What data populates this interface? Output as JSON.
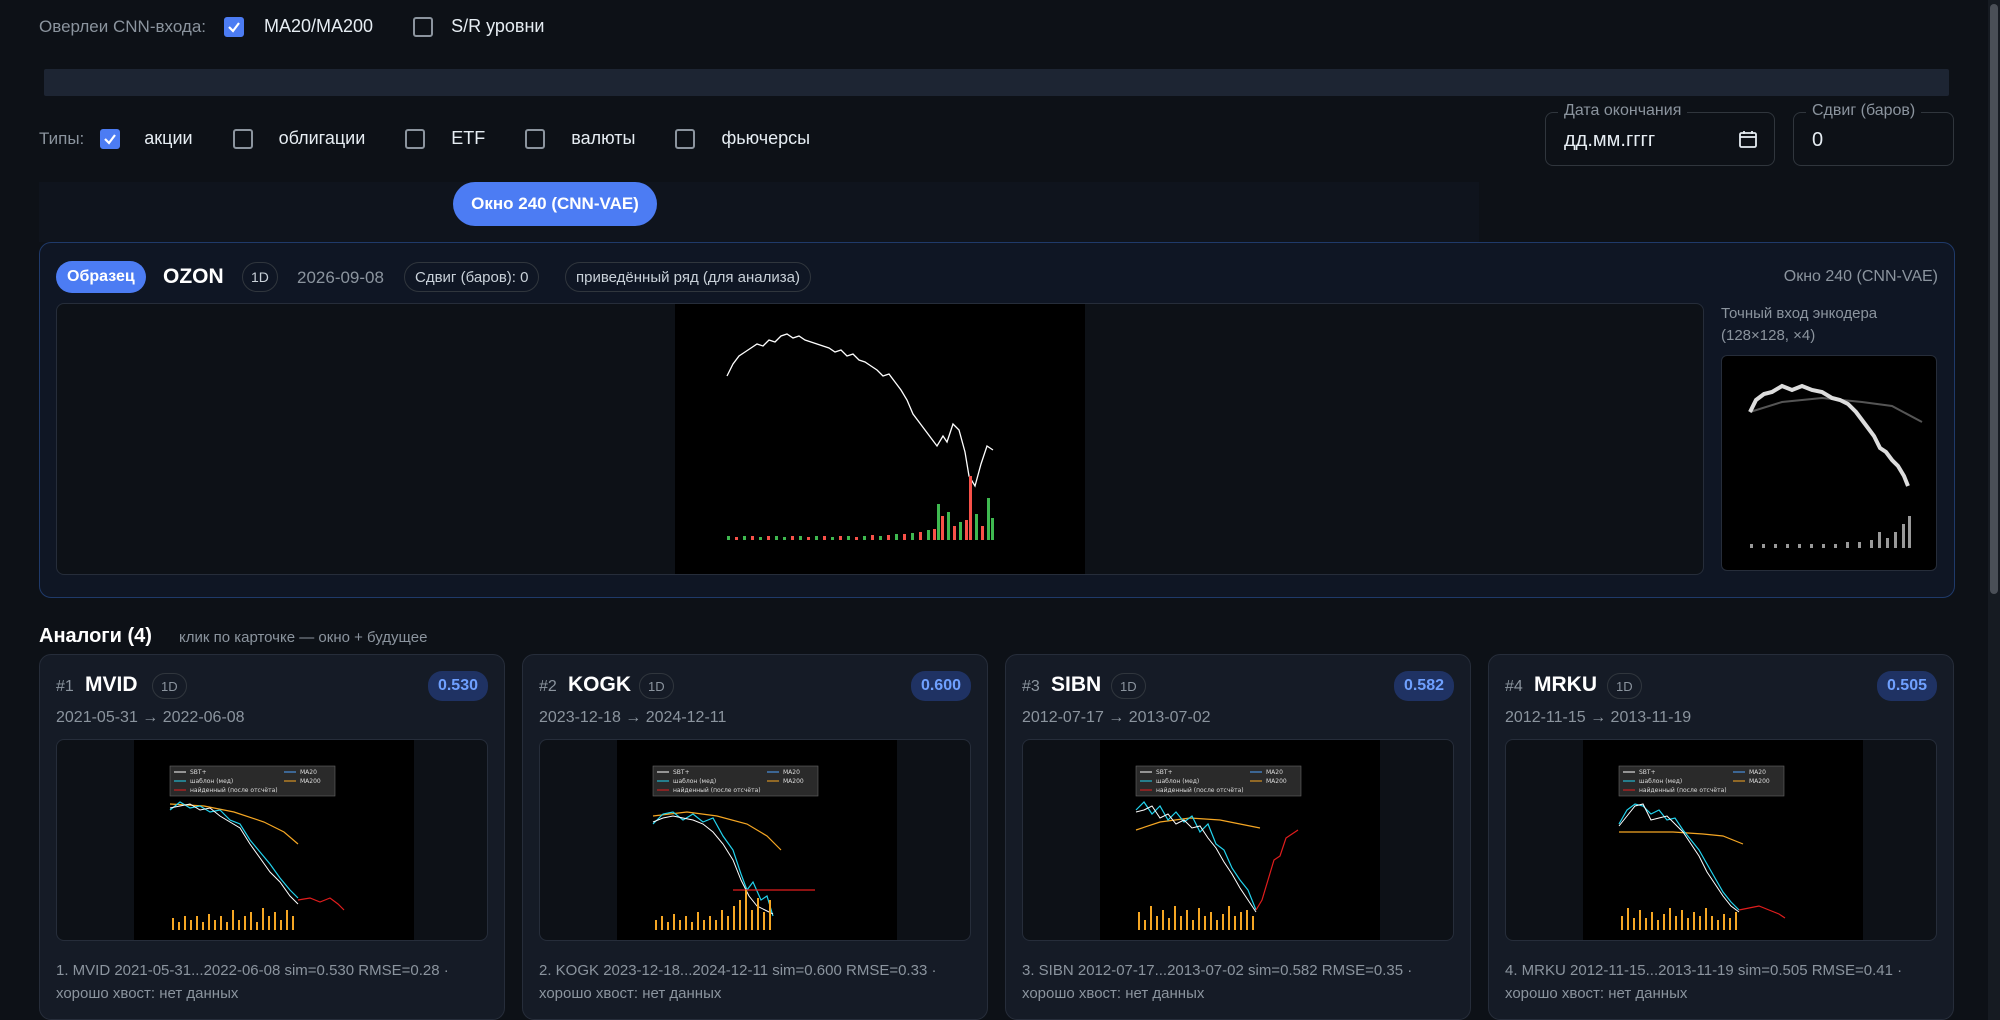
{
  "overlays": {
    "label": "Оверлеи CNN-входа:",
    "items": [
      {
        "label": "MA20/MA200",
        "checked": true
      },
      {
        "label": "S/R уровни",
        "checked": false
      }
    ]
  },
  "types": {
    "label": "Типы:",
    "items": [
      {
        "label": "акции",
        "checked": true
      },
      {
        "label": "облигации",
        "checked": false
      },
      {
        "label": "ETF",
        "checked": false
      },
      {
        "label": "валюты",
        "checked": false
      },
      {
        "label": "фьючерсы",
        "checked": false
      }
    ]
  },
  "end_date": {
    "legend": "Дата окончания",
    "value": "дд.мм.гггг"
  },
  "shift": {
    "legend": "Сдвиг (баров)",
    "value": "0"
  },
  "window_button": "Окно 240 (CNN-VAE)",
  "sample": {
    "badge": "Образец",
    "ticker": "OZON",
    "timeframe": "1D",
    "date": "2026-09-08",
    "shift_pill": "Сдвиг (баров): 0",
    "series_pill": "приведённый ряд (для анализа)",
    "window_label": "Окно 240 (CNN-VAE)",
    "encoder_title": "Точный вход энкодера",
    "encoder_sub": "(128×128, ×4)"
  },
  "analogs": {
    "title": "Аналоги (4)",
    "hint": "клик по карточке — окно + будущее",
    "legend_labels": [
      "SBT+",
      "шаблон (мед)",
      "найденный (после отсчёта)",
      "MA20",
      "MA200"
    ],
    "cards": [
      {
        "num": "#1",
        "ticker": "MVID",
        "tf": "1D",
        "sim": "0.530",
        "dates": "2021-05-31 → 2022-06-08",
        "desc": "1. MVID 2021-05-31...2022-06-08 sim=0.530 RMSE=0.28 · хорошо хвост: нет данных"
      },
      {
        "num": "#2",
        "ticker": "KOGK",
        "tf": "1D",
        "sim": "0.600",
        "dates": "2023-12-18 → 2024-12-11",
        "desc": "2. KOGK 2023-12-18...2024-12-11 sim=0.600 RMSE=0.33 · хорошо хвост: нет данных"
      },
      {
        "num": "#3",
        "ticker": "SIBN",
        "tf": "1D",
        "sim": "0.582",
        "dates": "2012-07-17 → 2013-07-02",
        "desc": "3. SIBN 2012-07-17...2013-07-02 sim=0.582 RMSE=0.35 · хорошо хвост: нет данных"
      },
      {
        "num": "#4",
        "ticker": "MRKU",
        "tf": "1D",
        "sim": "0.505",
        "dates": "2012-11-15 → 2013-11-19",
        "desc": "4. MRKU 2012-11-15...2013-11-19 sim=0.505 RMSE=0.41 · хорошо хвост: нет данных"
      }
    ]
  },
  "colors": {
    "accent": "#4c7cf3",
    "panel_border": "#1f3a6a",
    "candle_up": "#3fb950",
    "candle_down": "#f85149",
    "ma20": "#4fa3ff",
    "ma200": "#f5a623",
    "pattern": "#22d3ee",
    "tail": "#e11d1d"
  }
}
